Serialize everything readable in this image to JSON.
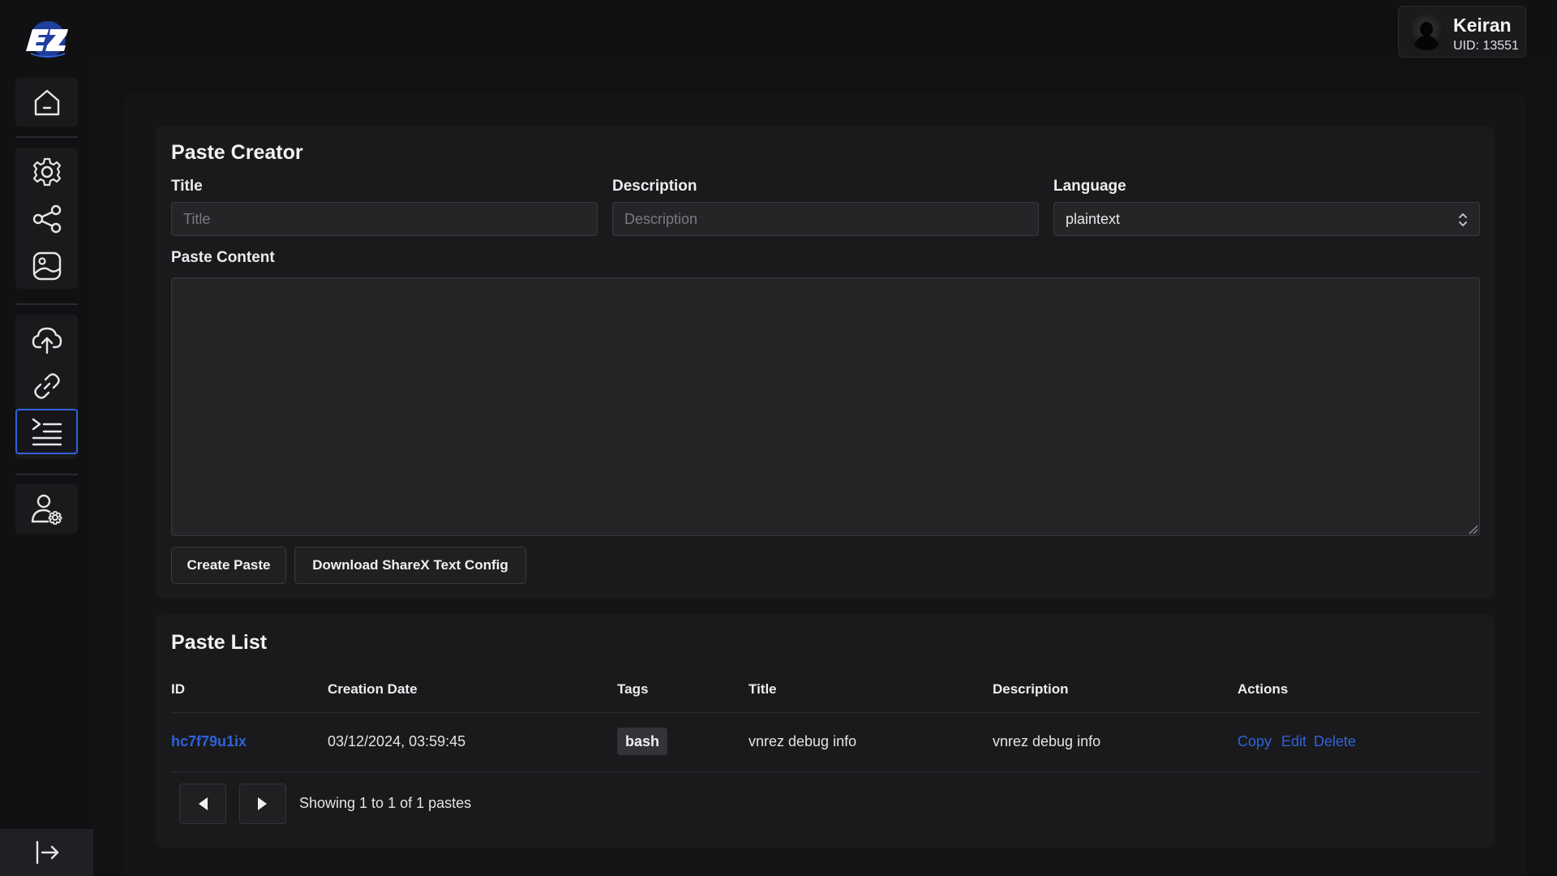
{
  "user": {
    "name": "Keiran",
    "uid": "UID: 13551"
  },
  "sidebar": {
    "items": [
      {
        "name": "home",
        "icon": "home-icon"
      },
      {
        "name": "settings",
        "icon": "gear-icon"
      },
      {
        "name": "share",
        "icon": "share-icon"
      },
      {
        "name": "gallery",
        "icon": "image-icon"
      },
      {
        "name": "upload",
        "icon": "cloud-upload-icon"
      },
      {
        "name": "shortener",
        "icon": "link-icon"
      },
      {
        "name": "paste",
        "icon": "terminal-list-icon",
        "active": true
      },
      {
        "name": "account",
        "icon": "user-gear-icon"
      }
    ],
    "logout_icon": "logout-icon"
  },
  "paste_creator": {
    "title": "Paste Creator",
    "title_label": "Title",
    "title_placeholder": "Title",
    "description_label": "Description",
    "description_placeholder": "Description",
    "language_label": "Language",
    "language_value": "plaintext",
    "content_label": "Paste Content",
    "content_value": "",
    "create_button": "Create Paste",
    "download_button": "Download ShareX Text Config"
  },
  "paste_list": {
    "title": "Paste List",
    "columns": [
      "ID",
      "Creation Date",
      "Tags",
      "Title",
      "Description",
      "Actions"
    ],
    "rows": [
      {
        "id": "hc7f79u1ix",
        "creation_date": "03/12/2024, 03:59:45",
        "tag": "bash",
        "title": "vnrez debug info",
        "description": "vnrez debug info",
        "actions": [
          "Copy",
          "Edit",
          "Delete"
        ]
      }
    ],
    "pager_text": "Showing 1 to 1 of 1 pastes"
  },
  "colors": {
    "accent": "#2f63d9",
    "background": "#111113",
    "card": "#1a1a1c"
  }
}
